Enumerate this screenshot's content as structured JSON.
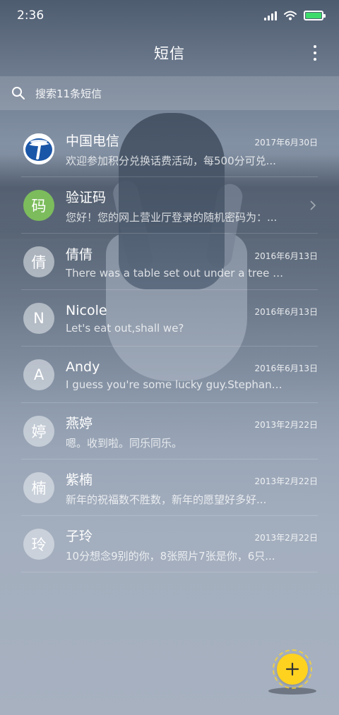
{
  "status_bar": {
    "time": "2:36"
  },
  "header": {
    "title": "短信"
  },
  "search": {
    "placeholder": "搜索11条短信"
  },
  "conversations": [
    {
      "name": "中国电信",
      "date": "2017年6月30日",
      "preview": "欢迎参加积分兑换话费活动，每500分可兑...",
      "avatar_type": "telecom-logo",
      "avatar_text": ""
    },
    {
      "name": "验证码",
      "date": "",
      "preview": "您好！您的网上营业厅登录的随机密码为：...",
      "avatar_type": "green",
      "avatar_text": "码"
    },
    {
      "name": "倩倩",
      "date": "2016年6月13日",
      "preview": "There was a table set out under a tree in...",
      "avatar_type": "grey",
      "avatar_text": "倩"
    },
    {
      "name": "Nicole",
      "date": "2016年6月13日",
      "preview": "Let's eat out,shall we?",
      "avatar_type": "grey",
      "avatar_text": "N"
    },
    {
      "name": "Andy",
      "date": "2016年6月13日",
      "preview": "I guess you're some lucky guy.Stephani...",
      "avatar_type": "grey",
      "avatar_text": "A"
    },
    {
      "name": "燕婷",
      "date": "2013年2月22日",
      "preview": "嗯。收到啦。同乐同乐。",
      "avatar_type": "grey",
      "avatar_text": "婷"
    },
    {
      "name": "紫楠",
      "date": "2013年2月22日",
      "preview": "新年的祝福数不胜数，新年的愿望好多好...",
      "avatar_type": "grey",
      "avatar_text": "楠"
    },
    {
      "name": "子玲",
      "date": "2013年2月22日",
      "preview": "10分想念9别的你，8张照片7张是你，6只...",
      "avatar_type": "grey",
      "avatar_text": "玲"
    }
  ],
  "icons": {
    "status": [
      "signal-icon",
      "wifi-icon",
      "battery-icon"
    ],
    "header": "more-vertical-icon",
    "search": "search-icon",
    "fab": "plus-icon",
    "row_2": "chevron-right-icon"
  },
  "colors": {
    "fab": "#ffd21f",
    "battery_level": "#3ddc6a",
    "verify_avatar": "#7cbc5c",
    "telecom_logo": "#1a56a8"
  }
}
